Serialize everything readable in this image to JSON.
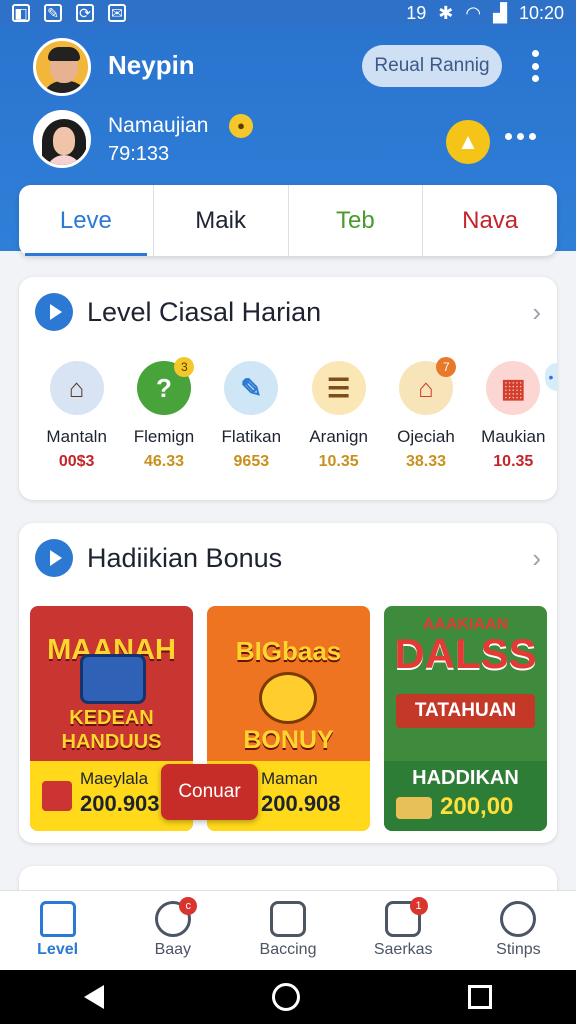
{
  "status": {
    "time": "10:20",
    "indicators": "19"
  },
  "user": {
    "name": "Neypin",
    "secondary_name": "Namaujian",
    "count": "79:133",
    "rank_button": "Reual Rannig"
  },
  "tabs": [
    {
      "label": "Leve",
      "color": "#2b79d2"
    },
    {
      "label": "Maik",
      "color": "#1d2330"
    },
    {
      "label": "Teb",
      "color": "#4a9a2d"
    },
    {
      "label": "Nava",
      "color": "#c4252a"
    }
  ],
  "daily": {
    "title": "Level Ciasal Harian",
    "items": [
      {
        "name": "Mantaln",
        "value": "00$3",
        "icon": "basket-icon",
        "glyph": "⌂",
        "bg": "#d8e4f4",
        "fg": "#5c3b28",
        "value_color": "#c4252a",
        "badge": ""
      },
      {
        "name": "Flemign",
        "value": "46.33",
        "icon": "question-icon",
        "glyph": "?",
        "bg": "#49a33b",
        "fg": "#fff",
        "value_color": "#c9901c",
        "badge": "3"
      },
      {
        "name": "Flatikan",
        "value": "9653",
        "icon": "tools-icon",
        "glyph": "✎",
        "bg": "#cfe6f7",
        "fg": "#2b79d2",
        "value_color": "#c9901c",
        "badge": ""
      },
      {
        "name": "Aranign",
        "value": "10.35",
        "icon": "document-icon",
        "glyph": "☰",
        "bg": "#fbe6b5",
        "fg": "#7c4f1a",
        "value_color": "#c9901c",
        "badge": ""
      },
      {
        "name": "Ojeciah",
        "value": "38.33",
        "icon": "house-icon",
        "glyph": "⌂",
        "bg": "#f7e4b9",
        "fg": "#d33e2d",
        "value_color": "#c9901c",
        "badge": "7"
      },
      {
        "name": "Maukian",
        "value": "10.35",
        "icon": "calculator-icon",
        "glyph": "▦",
        "bg": "#fbd6d3",
        "fg": "#d33e2d",
        "value_color": "#c4252a",
        "badge": ""
      }
    ]
  },
  "bonus": {
    "title": "Hadiikian Bonus",
    "cards": [
      {
        "title": "MAANAH",
        "subtitle": "KEDEAN\nHANDUUS",
        "footer_label": "Maeylala",
        "footer_amount": "200.903"
      },
      {
        "title": "BIGbaas",
        "subtitle": "BONUY",
        "footer_label": "Maman",
        "footer_amount": "200.908"
      },
      {
        "title": "DALSS",
        "top_label": "AAAKIAAN",
        "subtitle": "TATAHUAN",
        "footer_label": "HADDIKAN",
        "footer_amount": "200,00"
      }
    ],
    "overlay_button": "Conuar"
  },
  "bottom_nav": [
    {
      "label": "Level",
      "icon": "home-icon",
      "badge": ""
    },
    {
      "label": "Baay",
      "icon": "shield-icon",
      "badge": "c"
    },
    {
      "label": "Baccing",
      "icon": "grid-icon",
      "badge": ""
    },
    {
      "label": "Saerkas",
      "icon": "edit-icon",
      "badge": "1"
    },
    {
      "label": "Stinps",
      "icon": "profile-icon",
      "badge": ""
    }
  ]
}
